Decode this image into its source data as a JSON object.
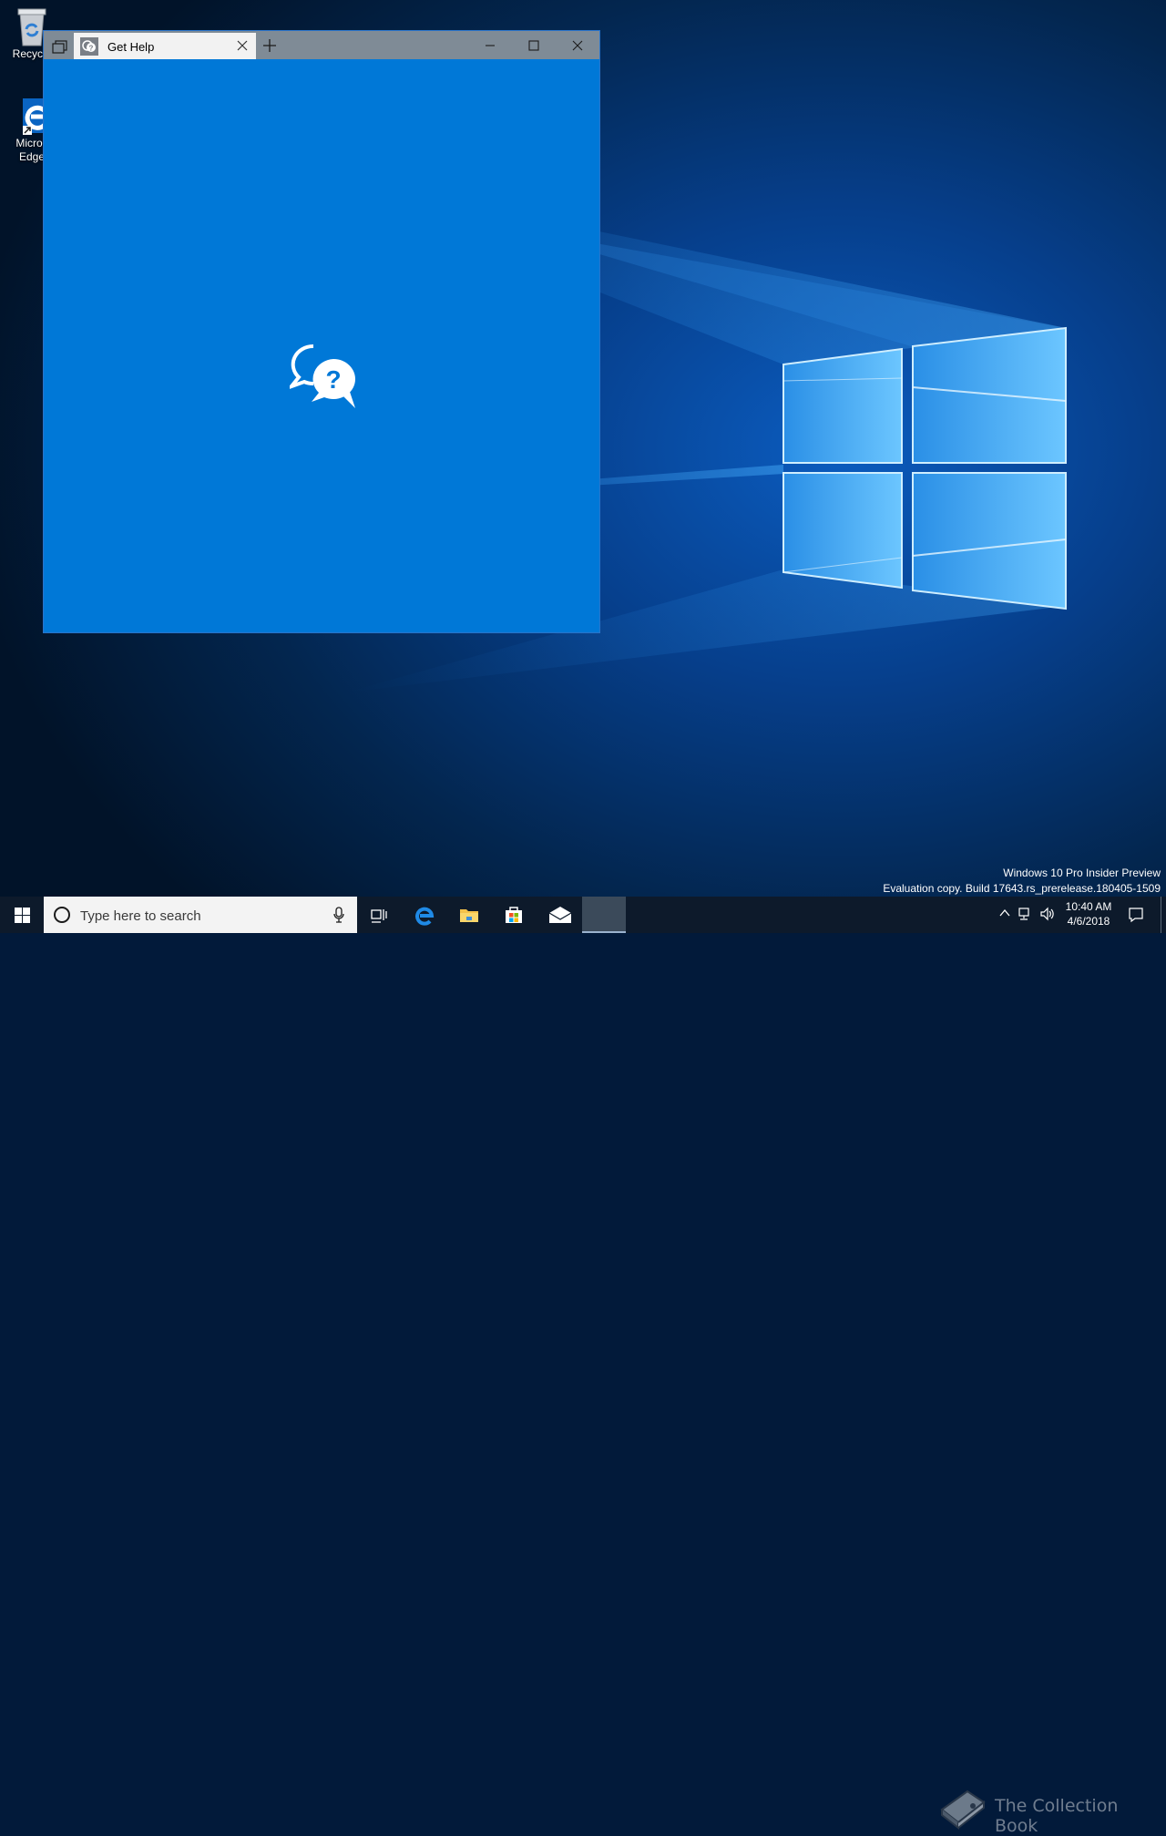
{
  "desktop": {
    "icons": [
      {
        "label": "Recycle",
        "icon": "recycle-bin-icon"
      },
      {
        "label_line1": "Micros",
        "label_line2": "Edge",
        "icon": "edge-icon"
      }
    ]
  },
  "window": {
    "tab_title": "Get Help",
    "app_icon": "get-help-icon",
    "buttons": [
      "tab-switcher",
      "tab-close",
      "new-tab",
      "minimize",
      "maximize",
      "close"
    ],
    "accent": "#0078d7",
    "titlebar_color": "#7f8b96"
  },
  "watermark": {
    "line1": "Windows 10 Pro Insider Preview",
    "line2": "Evaluation copy. Build 17643.rs_prerelease.180405-1509"
  },
  "taskbar": {
    "search_placeholder": "Type here to search",
    "pinned": [
      "task-view-icon",
      "edge-icon",
      "file-explorer-icon",
      "store-icon",
      "mail-icon"
    ],
    "clock_time": "10:40 AM",
    "clock_date": "4/6/2018",
    "overlay_text": "The Collection Book"
  }
}
